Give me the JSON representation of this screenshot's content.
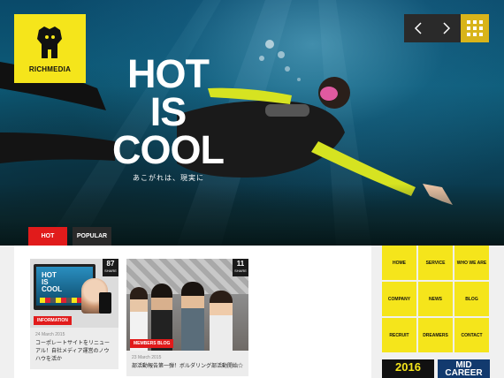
{
  "brand": {
    "name": "RICHMEDIA"
  },
  "hero": {
    "headline_line1": "HOT",
    "headline_line2": "IS",
    "headline_line3": "COOL",
    "tagline": "あこがれは、現実に"
  },
  "tabs": [
    {
      "label": "HOT"
    },
    {
      "label": "POPULAR"
    }
  ],
  "cards": [
    {
      "share_count": "87",
      "share_label": "SHARE",
      "category": "INFORMATION",
      "date": "24 March 2015",
      "title": "コーポレートサイトをリニューアル！自社メディア運営のノウハウを活か"
    },
    {
      "share_count": "11",
      "share_label": "SHARE",
      "category": "MEMBERS BLOG",
      "date": "23 March 2015",
      "title": "部活動報告第一弾！ボルダリング部活動開始☆"
    }
  ],
  "mini_mockup": {
    "line1": "HOT",
    "line2": "IS",
    "line3": "COOL"
  },
  "menu": [
    "HOME",
    "SERVICE",
    "WHO WE ARE",
    "COMPANY",
    "NEWS",
    "BLOG",
    "RECRUIT",
    "DREAMERS",
    "CONTACT"
  ],
  "banners": {
    "left": "2016",
    "right": "MID CAREER"
  },
  "colors": {
    "accent_yellow": "#f5e51b",
    "accent_red": "#e11b1b",
    "dark": "#2a2a2a",
    "grid_btn": "#d8b41a"
  }
}
